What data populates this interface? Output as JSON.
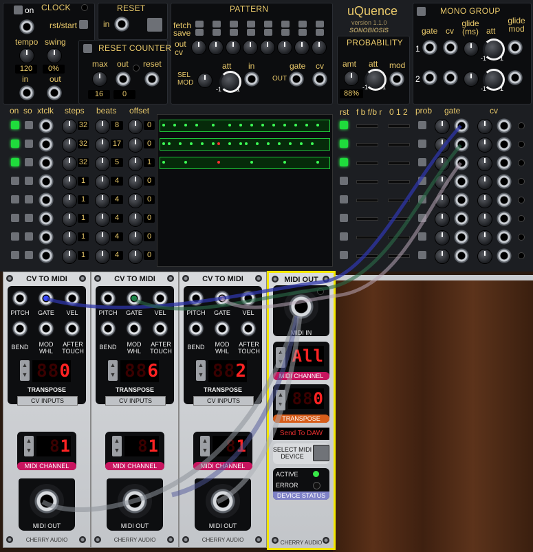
{
  "clock": {
    "title": "CLOCK",
    "on": "on",
    "rst_start": "rst/start",
    "tempo": "tempo",
    "swing": "swing",
    "tempo_value": "120",
    "swing_value": "0%",
    "in": "in",
    "out": "out"
  },
  "reset": {
    "title": "RESET",
    "in": "in"
  },
  "reset_counter": {
    "title": "RESET COUNTER",
    "max": "max",
    "out": "out",
    "reset": "reset",
    "max_value": "16",
    "out_value": "0"
  },
  "pattern": {
    "title": "PATTERN",
    "fetch": "fetch",
    "save": "save",
    "out_cv": "out cv",
    "sel_mod": "SEL MOD",
    "att": "att",
    "in": "in",
    "out": "OUT",
    "gate": "gate",
    "cv": "cv",
    "minus": "-1",
    "plus": "1"
  },
  "brand": {
    "name": "uQuence",
    "version": "version 1.1.0",
    "maker": "SONOBIOSIS"
  },
  "probability": {
    "title": "PROBABILITY",
    "amt": "amt",
    "att": "att",
    "mod": "mod",
    "value": "88%",
    "minus": "-1",
    "plus": "1"
  },
  "mono_group": {
    "title": "MONO GROUP",
    "gate": "gate",
    "cv": "cv",
    "glide_ms": "glide (ms)",
    "att": "att",
    "glide_mod": "glide mod",
    "row1": "1",
    "row2": "2",
    "minus": "-1",
    "plus": "1"
  },
  "columns": {
    "on": "on",
    "so": "so",
    "xtclk": "xtclk",
    "steps": "steps",
    "beats": "beats",
    "offset": "offset",
    "rst": "rst",
    "fb": "f b f/b r",
    "mode": "0 1 2",
    "prob": "prob",
    "gate": "gate",
    "cv": "cv"
  },
  "rows": [
    {
      "steps": "32",
      "beats": "8",
      "offset": "0",
      "on": true
    },
    {
      "steps": "32",
      "beats": "17",
      "offset": "0",
      "on": true
    },
    {
      "steps": "32",
      "beats": "5",
      "offset": "1",
      "on": true
    },
    {
      "steps": "1",
      "beats": "4",
      "offset": "0",
      "on": false
    },
    {
      "steps": "1",
      "beats": "4",
      "offset": "0",
      "on": false
    },
    {
      "steps": "1",
      "beats": "4",
      "offset": "0",
      "on": false
    },
    {
      "steps": "1",
      "beats": "4",
      "offset": "0",
      "on": false
    },
    {
      "steps": "1",
      "beats": "4",
      "offset": "0",
      "on": false
    }
  ],
  "cv_to_midi": [
    {
      "title": "CV TO MIDI",
      "pitch": "PITCH",
      "gate": "GATE",
      "vel": "VEL",
      "bend": "BEND",
      "mod_whl": "MOD WHL",
      "after_touch": "AFTER TOUCH",
      "transpose_value": "0",
      "transpose": "TRANSPOSE",
      "cv_inputs": "CV INPUTS",
      "channel_value": "1",
      "midi_channel": "MIDI CHANNEL",
      "midi_out": "MIDI OUT",
      "maker": "CHERRY AUDIO",
      "gate_color": "#3a4bff"
    },
    {
      "title": "CV TO MIDI",
      "pitch": "PITCH",
      "gate": "GATE",
      "vel": "VEL",
      "bend": "BEND",
      "mod_whl": "MOD WHL",
      "after_touch": "AFTER TOUCH",
      "transpose_value": "6",
      "transpose": "TRANSPOSE",
      "cv_inputs": "CV INPUTS",
      "channel_value": "1",
      "midi_channel": "MIDI CHANNEL",
      "midi_out": "MIDI OUT",
      "maker": "CHERRY AUDIO",
      "gate_color": "#1a8c4a"
    },
    {
      "title": "CV TO MIDI",
      "pitch": "PITCH",
      "gate": "GATE",
      "vel": "VEL",
      "bend": "BEND",
      "mod_whl": "MOD WHL",
      "after_touch": "AFTER TOUCH",
      "transpose_value": "2",
      "transpose": "TRANSPOSE",
      "cv_inputs": "CV INPUTS",
      "channel_value": "1",
      "midi_channel": "MIDI CHANNEL",
      "midi_out": "MIDI OUT",
      "maker": "CHERRY AUDIO",
      "gate_color": "#d8b8c8"
    }
  ],
  "midi_out": {
    "title": "MIDI OUT",
    "midi_in": "MIDI IN",
    "channel_value": "All",
    "midi_channel": "MIDI CHANNEL",
    "transpose_value": "0",
    "transpose": "TRANSPOSE",
    "send_to_daw": "Send To DAW",
    "select_device": "SELECT MIDI DEVICE",
    "active": "ACTIVE",
    "error": "ERROR",
    "device_status": "DEVICE STATUS",
    "maker": "CHERRY AUDIO"
  },
  "colors": {
    "accent": "#e8c86a",
    "led_green": "#1fdc3c",
    "midi_magenta": "#c8155f",
    "transpose_orange": "#d75d1a",
    "status_blue": "#7f82c8",
    "highlight_yellow": "#f2e600"
  }
}
